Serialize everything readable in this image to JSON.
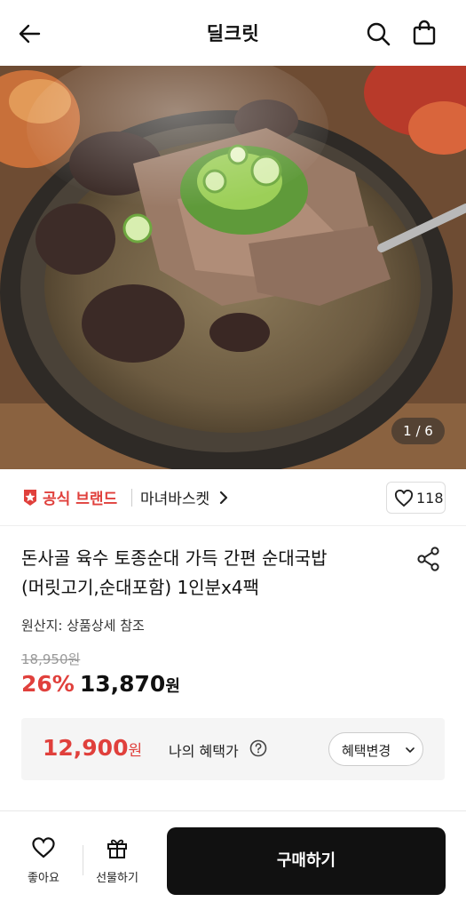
{
  "header": {
    "title": "딜크릿",
    "back_icon": "arrow-left-icon",
    "search_icon": "search-icon",
    "cart_icon": "shopping-bag-icon"
  },
  "gallery": {
    "current": 1,
    "total": 6,
    "indicator": "1 / 6"
  },
  "brand": {
    "badge_label": "공식 브랜드",
    "badge_icon": "official-star-icon",
    "store_name": "마녀바스켓",
    "like_count": "118"
  },
  "product": {
    "title_line1": "돈사골 육수 토종순대 가득 간편 순대국밥",
    "title_line2": "(머릿고기,순대포함) 1인분x4팩",
    "origin": "원산지: 상품상세 참조",
    "original_price": "18,950원",
    "discount_rate": "26%",
    "sale_price": "13,870",
    "won": "원"
  },
  "benefit": {
    "price": "12,900",
    "won": "원",
    "label": "나의 혜택가",
    "button_label": "혜택변경"
  },
  "bottom_bar": {
    "wish_label": "좋아요",
    "gift_label": "선물하기",
    "buy_label": "구매하기"
  },
  "colors": {
    "accent_red": "#e0403c",
    "buy_button": "#111111",
    "benefit_bg": "#f5f5f5"
  }
}
